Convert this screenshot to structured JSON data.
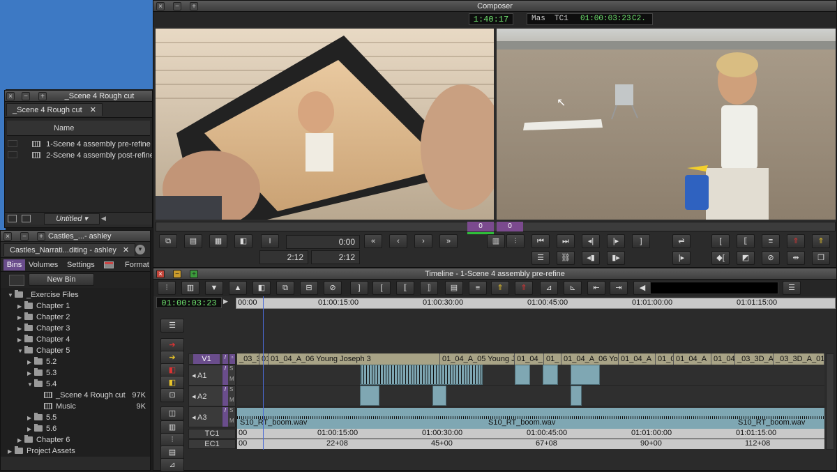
{
  "composer": {
    "title": "Composer",
    "src_timecode": "1:40:17",
    "rec_label": "Mas  TC1",
    "rec_timecode": "01:00:03:23",
    "rec_track": "C2.",
    "marker_left": "0",
    "marker_right": "0",
    "src_position": "0:00",
    "src_duration": "2:12",
    "rec_duration": "2:12"
  },
  "bin_window": {
    "title": "_Scene 4 Rough cut",
    "tab_label": "_Scene 4 Rough cut",
    "column_name": "Name",
    "items": [
      {
        "name": "1-Scene 4 assembly pre-refine"
      },
      {
        "name": "2-Scene 4 assembly post-refine"
      }
    ],
    "bin_view": "Untitled"
  },
  "project_window": {
    "title": "Castles_...- ashley",
    "tab_label": "Castles_Narrati...diting - ashley",
    "tabs": [
      "Bins",
      "Volumes",
      "Settings",
      "",
      "Format"
    ],
    "new_bin": "New Bin",
    "tree": [
      {
        "label": "_Exercise Files",
        "level": 0,
        "open": true,
        "size": ""
      },
      {
        "label": "Chapter 1",
        "level": 1,
        "open": false,
        "size": ""
      },
      {
        "label": "Chapter 2",
        "level": 1,
        "open": false,
        "size": ""
      },
      {
        "label": "Chapter 3",
        "level": 1,
        "open": false,
        "size": ""
      },
      {
        "label": "Chapter 4",
        "level": 1,
        "open": false,
        "size": ""
      },
      {
        "label": "Chapter 5",
        "level": 1,
        "open": true,
        "size": ""
      },
      {
        "label": "5.2",
        "level": 2,
        "open": false,
        "size": ""
      },
      {
        "label": "5.3",
        "level": 2,
        "open": false,
        "size": ""
      },
      {
        "label": "5.4",
        "level": 2,
        "open": true,
        "size": ""
      },
      {
        "label": "_Scene 4 Rough cut",
        "level": 3,
        "open": false,
        "size": "97K"
      },
      {
        "label": "Music",
        "level": 3,
        "open": false,
        "size": "9K"
      },
      {
        "label": "5.5",
        "level": 2,
        "open": false,
        "size": ""
      },
      {
        "label": "5.6",
        "level": 2,
        "open": false,
        "size": ""
      },
      {
        "label": "Chapter 6",
        "level": 1,
        "open": false,
        "size": ""
      },
      {
        "label": "Project Assets",
        "level": 0,
        "open": false,
        "size": ""
      }
    ]
  },
  "timeline": {
    "title": "Timeline - 1-Scene 4 assembly pre-refine",
    "timecode": "01:00:03:23",
    "ruler": [
      "00:00",
      "01:00:15:00",
      "01:00:30:00",
      "01:00:45:00",
      "01:01:00:00",
      "01:01:15:00"
    ],
    "tracks": {
      "v1": "V1",
      "a1": "A1",
      "a2": "A2",
      "a3": "A3",
      "tc1": "TC1",
      "ec1": "EC1"
    },
    "v1_clips": [
      {
        "label": "_03_3",
        "w": 2.5
      },
      {
        "label": "01",
        "w": 1
      },
      {
        "label": "01_04_A_06 Young Joseph 3",
        "w": 19.5
      },
      {
        "label": "01_04_A_05 Young Jos",
        "w": 8.5
      },
      {
        "label": "01_04_",
        "w": 3.3
      },
      {
        "label": "01_",
        "w": 2
      },
      {
        "label": "01_04_A_06 Yo",
        "w": 6.5
      },
      {
        "label": "01_04_A",
        "w": 4.2
      },
      {
        "label": "01_0",
        "w": 2.1
      },
      {
        "label": "01_04_A",
        "w": 4.3
      },
      {
        "label": "01_04",
        "w": 2.7
      },
      {
        "label": "_03_3D_A",
        "w": 4.4
      },
      {
        "label": "_03_3D_A_01",
        "w": 5.8
      }
    ],
    "a3_clips": [
      "S10_RT_boom.wav",
      "S10_RT_boom.wav",
      "S10_RT_boom.wav"
    ],
    "tc1_ruler": [
      "00",
      "01:00:15:00",
      "01:00:30:00",
      "01:00:45:00",
      "01:01:00:00",
      "01:01:15:00"
    ],
    "ec1_ruler": [
      "00",
      "22+08",
      "45+00",
      "67+08",
      "90+00",
      "112+08"
    ]
  },
  "colors": {
    "accent": "#6a4d8c",
    "timecode_green": "#6fe36f",
    "video_clip": "#a8a386",
    "audio_clip": "#7fa7b3",
    "desktop_blue": "#3d79c4"
  }
}
